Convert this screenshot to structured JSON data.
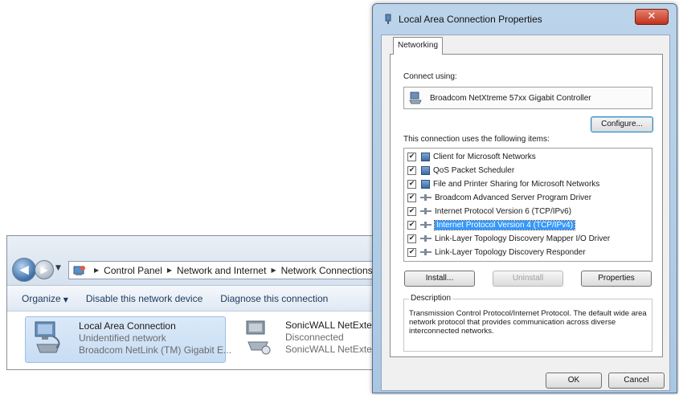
{
  "explorer": {
    "breadcrumb": [
      "Control Panel",
      "Network and Internet",
      "Network Connections"
    ],
    "toolbar": {
      "organize": "Organize",
      "disable": "Disable this network device",
      "diagnose": "Diagnose this connection"
    },
    "connections": [
      {
        "name": "Local Area Connection",
        "status": "Unidentified network",
        "adapter": "Broadcom NetLink (TM) Gigabit E..."
      },
      {
        "name": "SonicWALL NetExtender",
        "status": "Disconnected",
        "adapter": "SonicWALL NetExtender"
      }
    ]
  },
  "dialog": {
    "title": "Local Area Connection Properties",
    "close_glyph": "✕",
    "tab": "Networking",
    "connect_using_label": "Connect using:",
    "adapter": "Broadcom NetXtreme 57xx Gigabit Controller",
    "configure_label": "Configure...",
    "items_label": "This connection uses the following items:",
    "items": [
      {
        "label": "Client for Microsoft Networks",
        "checked": true,
        "selected": false,
        "icon": "network-client-icon"
      },
      {
        "label": "QoS Packet Scheduler",
        "checked": true,
        "selected": false,
        "icon": "network-service-icon"
      },
      {
        "label": "File and Printer Sharing for Microsoft Networks",
        "checked": true,
        "selected": false,
        "icon": "network-service-icon"
      },
      {
        "label": "Broadcom Advanced Server Program Driver",
        "checked": true,
        "selected": false,
        "icon": "protocol-icon"
      },
      {
        "label": "Internet Protocol Version 6 (TCP/IPv6)",
        "checked": true,
        "selected": false,
        "icon": "protocol-icon"
      },
      {
        "label": "Internet Protocol Version 4 (TCP/IPv4)",
        "checked": true,
        "selected": true,
        "icon": "protocol-icon"
      },
      {
        "label": "Link-Layer Topology Discovery Mapper I/O Driver",
        "checked": true,
        "selected": false,
        "icon": "protocol-icon"
      },
      {
        "label": "Link-Layer Topology Discovery Responder",
        "checked": true,
        "selected": false,
        "icon": "protocol-icon"
      }
    ],
    "install_label": "Install...",
    "uninstall_label": "Uninstall",
    "properties_label": "Properties",
    "description_title": "Description",
    "description_text": "Transmission Control Protocol/Internet Protocol. The default wide area network protocol that provides communication across diverse interconnected networks.",
    "ok_label": "OK",
    "cancel_label": "Cancel"
  },
  "colors": {
    "selection": "#3399ff",
    "title_bar": "#bcd4ea",
    "close_button": "#c0321e"
  }
}
